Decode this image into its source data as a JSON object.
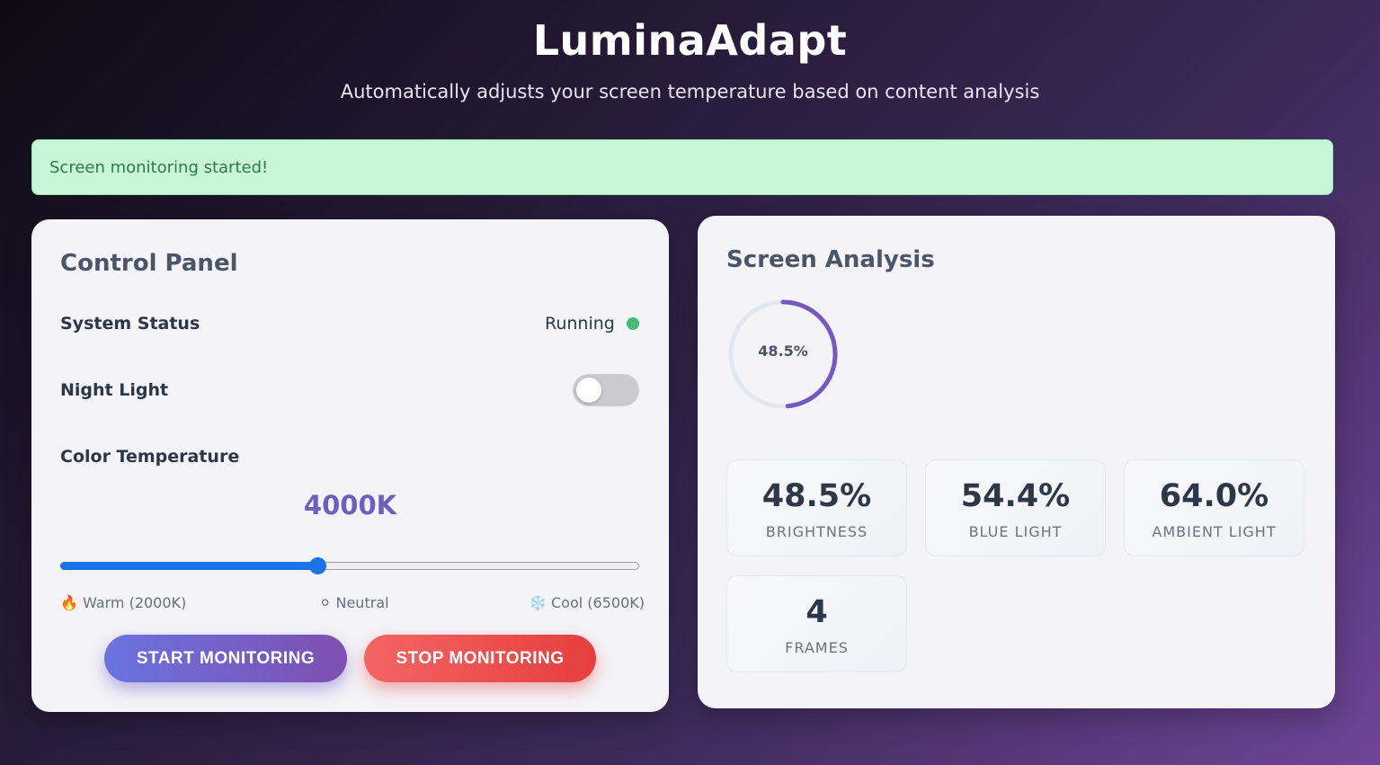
{
  "header": {
    "title": "LuminaAdapt",
    "subtitle": "Automatically adjusts your screen temperature based on content analysis"
  },
  "alert": {
    "message": "Screen monitoring started!"
  },
  "control_panel": {
    "title": "Control Panel",
    "system_status_label": "System Status",
    "system_status_value": "Running",
    "night_light_label": "Night Light",
    "night_light_on": false,
    "color_temp_label": "Color Temperature",
    "color_temp_value": "4000K",
    "slider": {
      "min": 2000,
      "max": 6500,
      "value": 4000
    },
    "scale": {
      "warm": "🔥 Warm (2000K)",
      "neutral": "⚪ Neutral",
      "cool": "❄️ Cool (6500K)"
    },
    "start_button": "START MONITORING",
    "stop_button": "STOP MONITORING"
  },
  "analysis": {
    "title": "Screen Analysis",
    "gauge_value": 48.5,
    "gauge_text": "48.5%",
    "stats": [
      {
        "value": "48.5%",
        "label": "BRIGHTNESS"
      },
      {
        "value": "54.4%",
        "label": "BLUE LIGHT"
      },
      {
        "value": "64.0%",
        "label": "AMBIENT LIGHT"
      },
      {
        "value": "4",
        "label": "FRAMES"
      }
    ]
  },
  "colors": {
    "accent": "#6b5fc0",
    "status_ok": "#48bb78",
    "slider": "#1a73e8",
    "alert_bg": "#c6f6d5",
    "stop": "#e53e3e"
  }
}
